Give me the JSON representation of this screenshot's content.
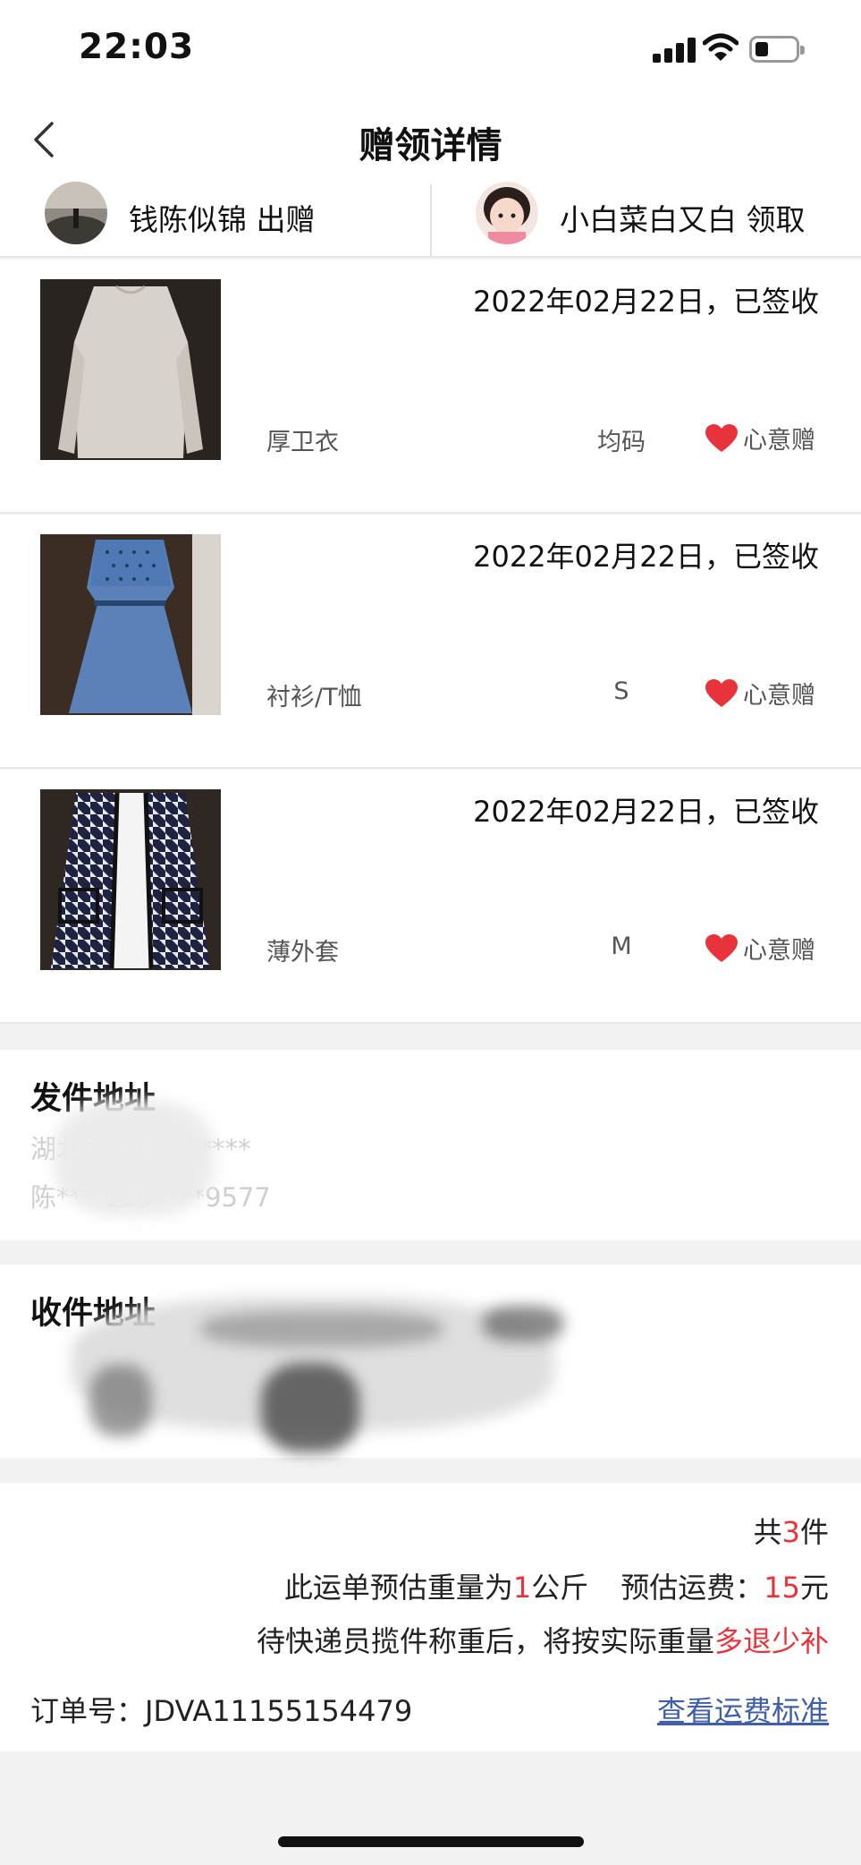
{
  "status_bar": {
    "time": "22:03"
  },
  "nav": {
    "title": "赠领详情"
  },
  "giver": {
    "text": "钱陈似锦 出赠"
  },
  "receiver": {
    "text": "小白菜白又白 领取"
  },
  "items": [
    {
      "date_status": "2022年02月22日，已签收",
      "category": "厚卫衣",
      "size": "均码",
      "tag": "心意赠"
    },
    {
      "date_status": "2022年02月22日，已签收",
      "category": "衬衫/T恤",
      "size": "S",
      "tag": "心意赠"
    },
    {
      "date_status": "2022年02月22日，已签收",
      "category": "薄外套",
      "size": "M",
      "tag": "心意赠"
    }
  ],
  "sender_address": {
    "label": "发件地址",
    "line1": "湖北武汉市*******",
    "line2": "陈*** 139****9577"
  },
  "receiver_address": {
    "label": "收件地址"
  },
  "summary": {
    "count_prefix": "共",
    "count": "3",
    "count_suffix": "件",
    "weight_prefix": "此运单预估重量为",
    "weight": "1",
    "weight_unit": "公斤",
    "fee_prefix": "预估运费：",
    "fee": "15",
    "fee_unit": "元",
    "note_prefix": "待快递员揽件称重后，将按实际重量",
    "note_highlight": "多退少补",
    "order_label": "订单号：",
    "order_number": "JDVA11155154479",
    "fee_standard_link": "查看运费标准"
  },
  "colors": {
    "accent_red": "#e8333c",
    "link_blue": "#3f5fa8"
  }
}
